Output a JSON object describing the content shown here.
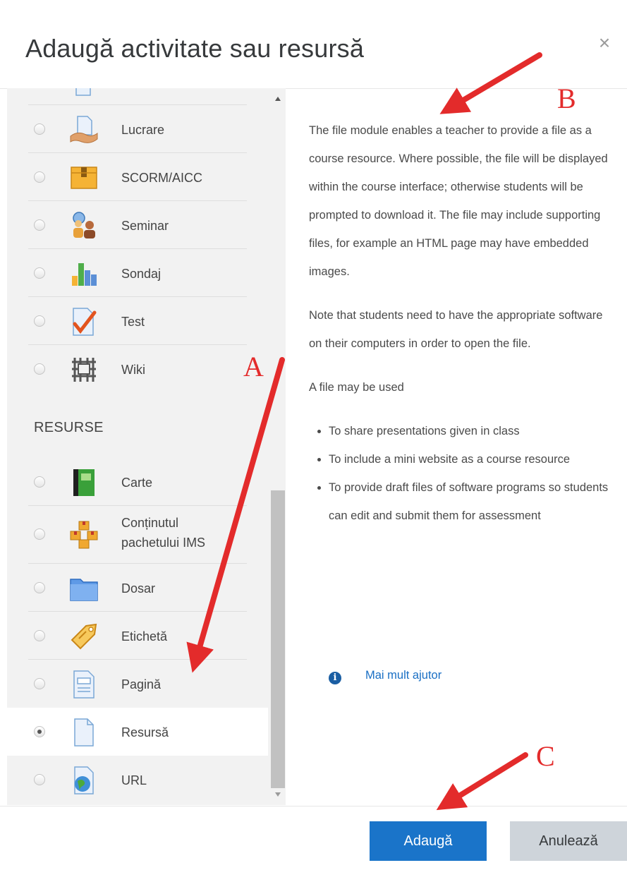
{
  "dialog": {
    "title": "Adaugă activitate sau resursă",
    "close_glyph": "×"
  },
  "list": {
    "section_label": "RESURSE",
    "activities": [
      {
        "label": "Lucrare",
        "icon": "assignment-icon",
        "selected": false
      },
      {
        "label": "SCORM/AICC",
        "icon": "scorm-package-icon",
        "selected": false
      },
      {
        "label": "Seminar",
        "icon": "workshop-icon",
        "selected": false
      },
      {
        "label": "Sondaj",
        "icon": "survey-chart-icon",
        "selected": false
      },
      {
        "label": "Test",
        "icon": "quiz-checkmark-icon",
        "selected": false
      },
      {
        "label": "Wiki",
        "icon": "wiki-icon",
        "selected": false
      }
    ],
    "resources": [
      {
        "label": "Carte",
        "icon": "book-icon",
        "selected": false
      },
      {
        "label": "Conținutul pachetului IMS",
        "line1": "Conținutul",
        "line2": "pachetului IMS",
        "icon": "ims-package-icon",
        "selected": false
      },
      {
        "label": "Dosar",
        "icon": "folder-icon",
        "selected": false
      },
      {
        "label": "Etichetă",
        "icon": "label-tag-icon",
        "selected": false
      },
      {
        "label": "Pagină",
        "icon": "page-icon",
        "selected": false
      },
      {
        "label": "Resursă",
        "icon": "file-icon",
        "selected": true
      },
      {
        "label": "URL",
        "icon": "url-globe-icon",
        "selected": false
      }
    ]
  },
  "help": {
    "paragraph1": "The file module enables a teacher to provide a file as a course resource. Where possible, the file will be displayed within the course interface; otherwise students will be prompted to download it. The file may include supporting files, for example an HTML page may have embedded images.",
    "paragraph2": "Note that students need to have the appropriate software on their computers in order to open the file.",
    "paragraph3": "A file may be used",
    "bullets": [
      "To share presentations given in class",
      "To include a mini website as a course resource",
      "To provide draft files of software programs so students can edit and submit them for assessment"
    ],
    "more_help_link": "Mai mult ajutor",
    "info_glyph": "i"
  },
  "footer": {
    "add_label": "Adaugă",
    "cancel_label": "Anulează"
  },
  "annotations": {
    "label_a": "A",
    "label_b": "B",
    "label_c": "C",
    "color": "#e32b2b"
  },
  "colors": {
    "primary": "#1a74c9",
    "list_background": "#f2f2f2",
    "link": "#1a6fc4"
  }
}
